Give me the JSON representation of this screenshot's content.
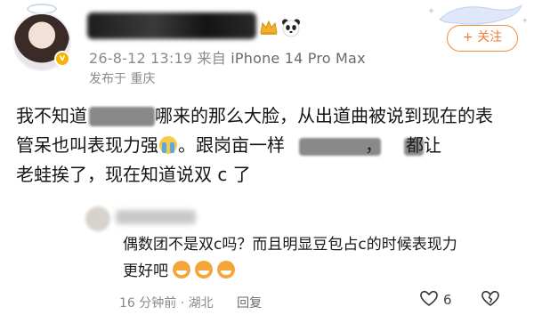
{
  "post": {
    "timestamp": "26-8-12 13:19",
    "source_prefix": "来自",
    "device": "iPhone 14 Pro Max",
    "location": "发布于 重庆",
    "follow_label": "+ 关注",
    "lines": [
      "我不知道",
      "哪来的那么大脸，从出道曲被说到现在的表",
      "管呆也叫表现力强",
      "。跟岗亩一样",
      "，",
      "都让",
      "老蛙挨了，现在知道说双 c 了"
    ]
  },
  "comment": {
    "lines": [
      "偶数团不是双c吗？而且明显豆包占c的时候表现力",
      "更好吧"
    ],
    "time": "16 分钟前",
    "location": "· 湖北",
    "reply_label": "回复",
    "likes": "6"
  },
  "icons": {
    "crown": "crown-icon",
    "panda": "panda-icon",
    "like": "heart-outline-icon",
    "dislike": "broken-heart-icon"
  },
  "colors": {
    "accent": "#f07d2c",
    "meta_text": "#8a8a8a"
  }
}
